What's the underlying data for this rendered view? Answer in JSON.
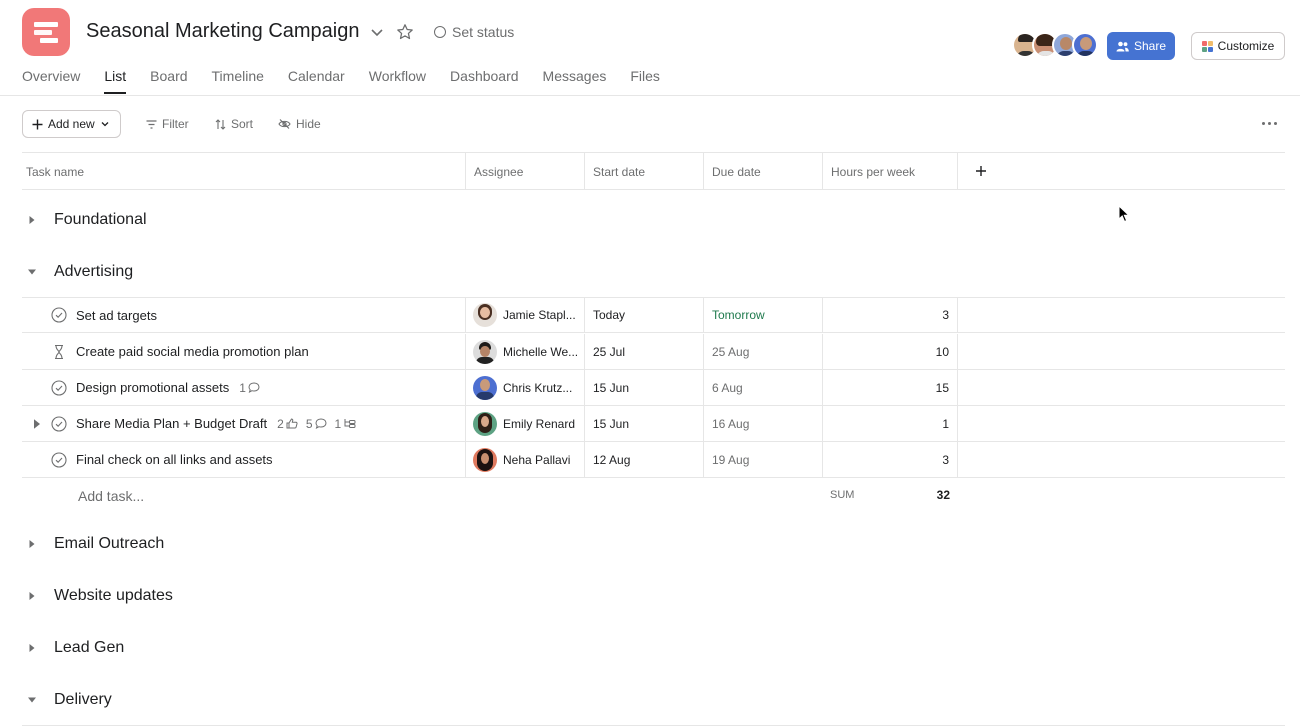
{
  "project": {
    "title": "Seasonal Marketing Campaign",
    "status_label": "Set status",
    "icon_color": "#f06a6a"
  },
  "header": {
    "share_label": "Share",
    "customize_label": "Customize",
    "accent_color": "#4573d2"
  },
  "tabs": [
    {
      "label": "Overview"
    },
    {
      "label": "List",
      "active": true
    },
    {
      "label": "Board"
    },
    {
      "label": "Timeline"
    },
    {
      "label": "Calendar"
    },
    {
      "label": "Workflow"
    },
    {
      "label": "Dashboard"
    },
    {
      "label": "Messages"
    },
    {
      "label": "Files"
    }
  ],
  "toolbar": {
    "add_new_label": "Add new",
    "filter_label": "Filter",
    "sort_label": "Sort",
    "hide_label": "Hide"
  },
  "columns": {
    "task_name": "Task name",
    "assignee": "Assignee",
    "start_date": "Start date",
    "due_date": "Due date",
    "hours": "Hours per week"
  },
  "sections": [
    {
      "name": "Foundational",
      "expanded": false
    },
    {
      "name": "Advertising",
      "expanded": true
    },
    {
      "name": "Email Outreach",
      "expanded": false
    },
    {
      "name": "Website updates",
      "expanded": false
    },
    {
      "name": "Lead Gen",
      "expanded": false
    },
    {
      "name": "Delivery",
      "expanded": true
    }
  ],
  "tasks": [
    {
      "name": "Set ad targets",
      "icon": "check-circle-icon",
      "assignee": "Jamie Stapl...",
      "start": "Today",
      "due": "Tomorrow",
      "due_color": "#1f7a4d",
      "hours": "3"
    },
    {
      "name": "Create paid social media promotion plan",
      "icon": "hourglass-icon",
      "assignee": "Michelle We...",
      "start": "25 Jul",
      "due": "25 Aug",
      "hours": "10"
    },
    {
      "name": "Design promotional assets",
      "icon": "check-circle-icon",
      "comments": "1",
      "assignee": "Chris Krutz...",
      "start": "15 Jun",
      "due": "6 Aug",
      "hours": "15"
    },
    {
      "name": "Share Media Plan + Budget Draft",
      "icon": "check-circle-icon",
      "likes": "2",
      "comments": "5",
      "subtasks": "1",
      "assignee": "Emily Renard",
      "start": "15 Jun",
      "due": "16 Aug",
      "hours": "1"
    },
    {
      "name": "Final check on all links and assets",
      "icon": "check-circle-icon",
      "assignee": "Neha Pallavi",
      "start": "12 Aug",
      "due": "19 Aug",
      "hours": "3"
    }
  ],
  "footer": {
    "add_task_label": "Add task...",
    "sum_label": "SUM",
    "sum_value": "32"
  }
}
